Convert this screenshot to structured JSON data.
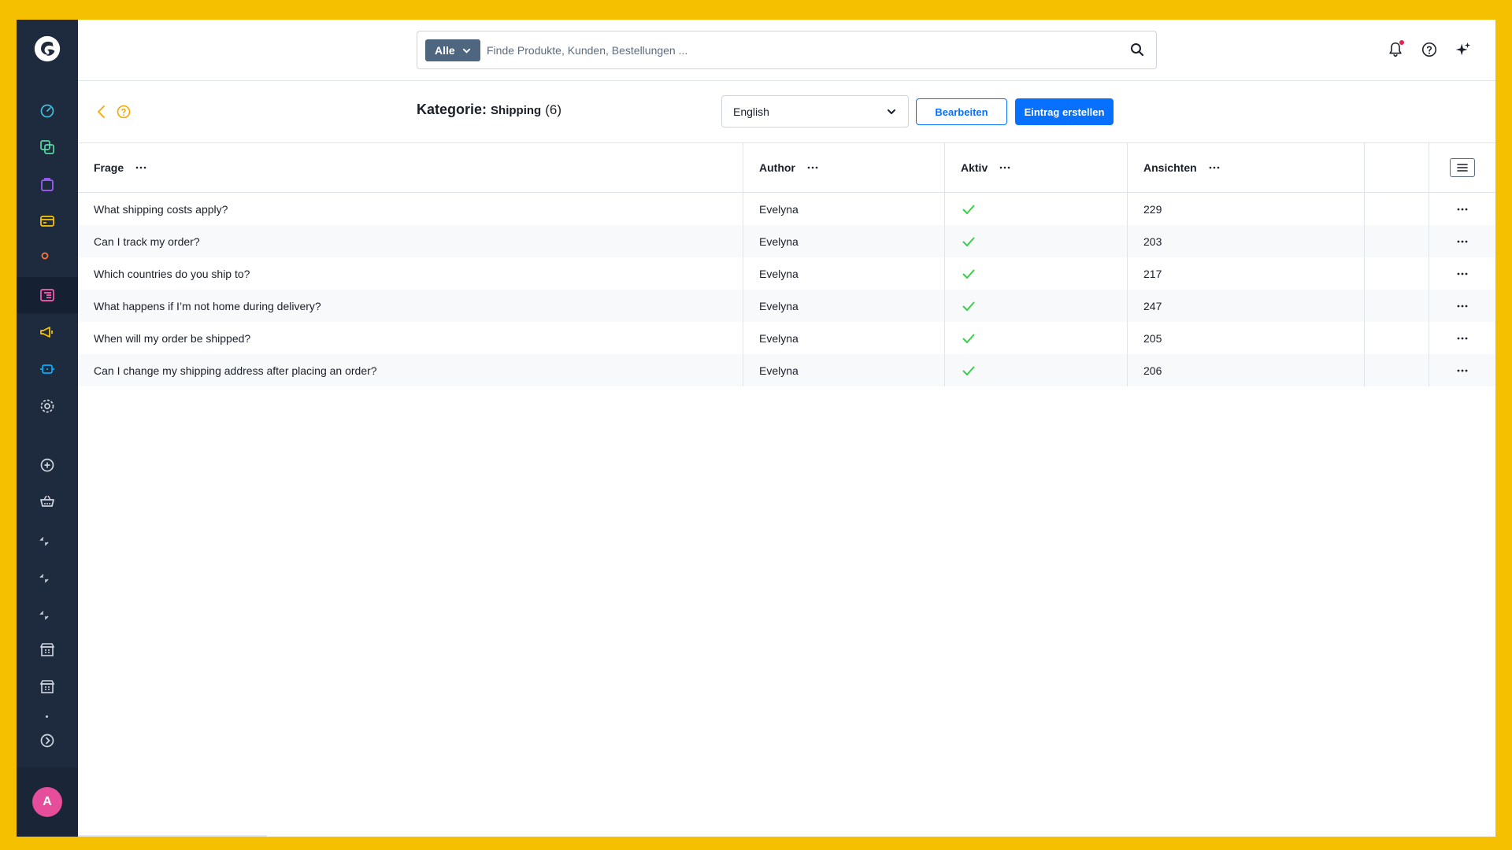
{
  "colors": {
    "accent": "#0870ff",
    "sidebar_bg": "#1e2a3d",
    "check": "#37d046",
    "frame": "#f5c000"
  },
  "sidebar": {
    "logo_icon": "shopware-logo",
    "items": [
      {
        "icon": "dashboard-icon"
      },
      {
        "icon": "catalogue-icon"
      },
      {
        "icon": "orders-icon"
      },
      {
        "icon": "payment-icon"
      },
      {
        "icon": "customers-icon"
      },
      {
        "icon": "content-icon",
        "active": true
      },
      {
        "icon": "marketing-icon"
      },
      {
        "icon": "extensions-icon"
      },
      {
        "icon": "settings-icon"
      },
      {
        "icon": "add-icon"
      },
      {
        "icon": "basket-icon"
      },
      {
        "icon": "rocket-icon"
      },
      {
        "icon": "rocket-icon"
      },
      {
        "icon": "rocket-icon"
      },
      {
        "icon": "store-icon"
      },
      {
        "icon": "store-icon"
      },
      {
        "icon": "collapse-icon"
      }
    ],
    "avatar_initial": "A"
  },
  "search": {
    "filter_label": "Alle",
    "placeholder": "Finde Produkte, Kunden, Bestellungen ..."
  },
  "header_icons": [
    "bell-icon",
    "help-icon",
    "sparkle-icon"
  ],
  "page": {
    "title_label": "Kategorie:",
    "category": "Shipping",
    "count": "(6)"
  },
  "language_select": {
    "value": "English"
  },
  "buttons": {
    "edit": "Bearbeiten",
    "create": "Eintrag erstellen"
  },
  "table": {
    "columns": {
      "question": "Frage",
      "author": "Author",
      "active": "Aktiv",
      "views": "Ansichten"
    },
    "rows": [
      {
        "question": "What shipping costs apply?",
        "author": "Evelyna",
        "active": true,
        "views": "229"
      },
      {
        "question": "Can I track my order?",
        "author": "Evelyna",
        "active": true,
        "views": "203"
      },
      {
        "question": "Which countries do you ship to?",
        "author": "Evelyna",
        "active": true,
        "views": "217"
      },
      {
        "question": "What happens if I’m not home during delivery?",
        "author": "Evelyna",
        "active": true,
        "views": "247"
      },
      {
        "question": "When will my order be shipped?",
        "author": "Evelyna",
        "active": true,
        "views": "205"
      },
      {
        "question": "Can I change my shipping address after placing an order?",
        "author": "Evelyna",
        "active": true,
        "views": "206"
      }
    ]
  }
}
